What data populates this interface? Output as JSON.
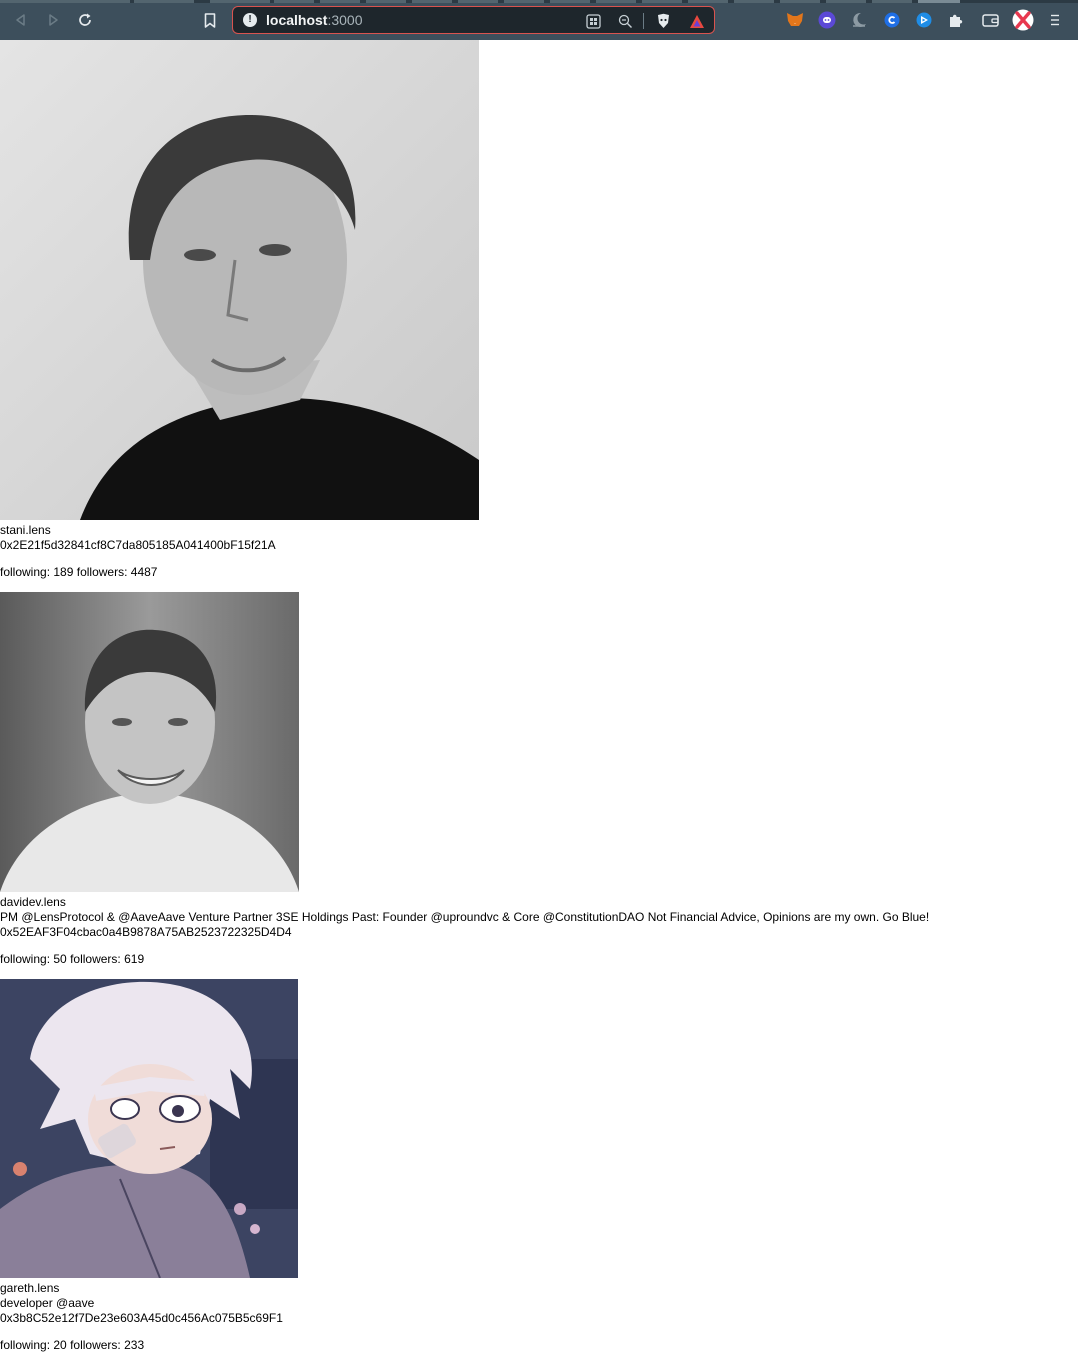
{
  "browser": {
    "url_host": "localhost",
    "url_port": ":3000",
    "icons": [
      "back-icon",
      "forward-icon",
      "reload-icon",
      "bookmark-icon",
      "site-info-icon",
      "qr-code-icon",
      "zoom-out-icon",
      "brave-shields-icon",
      "brave-rewards-icon",
      "metamask-icon",
      "ghost-extension-icon",
      "night-mode-icon",
      "coinbase-icon",
      "extension-icon",
      "extensions-icon",
      "wallet-icon",
      "profile-extension-icon",
      "menu-icon"
    ]
  },
  "profiles": [
    {
      "handle": "stani.lens",
      "bio": "",
      "address": "0x2E21f5d32841cf8C7da805185A041400bF15f21A",
      "following_label": "following:",
      "following": "189",
      "followers_label": "followers:",
      "followers": "4487"
    },
    {
      "handle": "davidev.lens",
      "bio": "PM @LensProtocol & @AaveAave Venture Partner 3SE Holdings Past: Founder @uproundvc & Core @ConstitutionDAO Not Financial Advice, Opinions are my own. Go Blue!",
      "address": "0x52EAF3F04cbac0a4B9878A75AB2523722325D4D4",
      "following_label": "following:",
      "following": "50",
      "followers_label": "followers:",
      "followers": "619"
    },
    {
      "handle": "gareth.lens",
      "bio": "developer @aave",
      "address": "0x3b8C52e12f7De23e603A45d0c456Ac075B5c69F1",
      "following_label": "following:",
      "following": "20",
      "followers_label": "followers:",
      "followers": "233"
    }
  ],
  "colors": {
    "chrome": "#3d4f5c",
    "urlbar_border": "#d9534f",
    "page_bg": "#ffffff",
    "text": "#000000"
  }
}
